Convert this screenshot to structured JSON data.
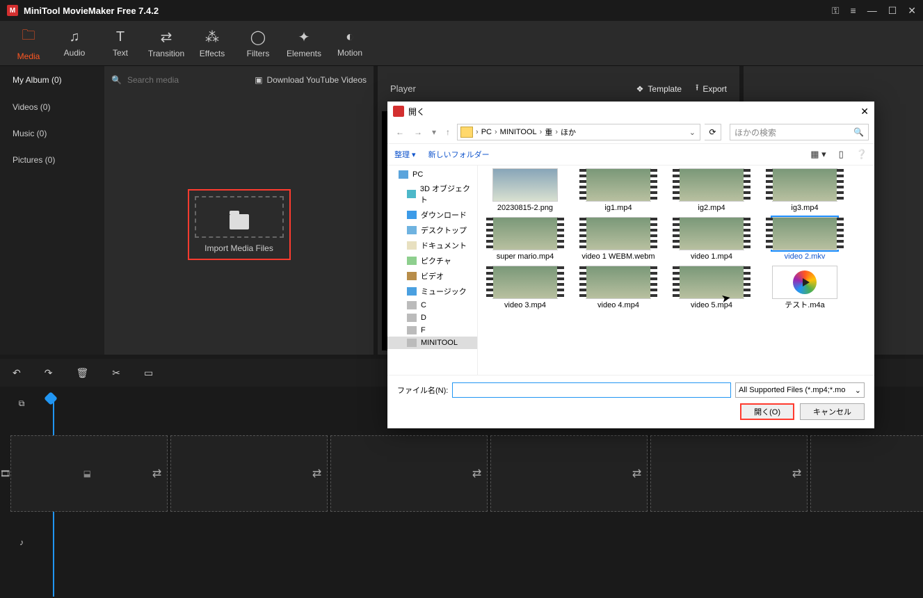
{
  "app": {
    "title": "MiniTool MovieMaker Free 7.4.2"
  },
  "tabs": {
    "media": "Media",
    "audio": "Audio",
    "text": "Text",
    "transition": "Transition",
    "effects": "Effects",
    "filters": "Filters",
    "elements": "Elements",
    "motion": "Motion"
  },
  "album": {
    "myalbum": "My Album (0)",
    "videos": "Videos (0)",
    "music": "Music (0)",
    "pictures": "Pictures (0)",
    "search_placeholder": "Search media",
    "download_yt": "Download YouTube Videos",
    "import_label": "Import Media Files"
  },
  "player": {
    "title": "Player",
    "template": "Template",
    "export": "Export"
  },
  "fileDialog": {
    "title": "開く",
    "path": {
      "pc": "PC",
      "minitool": "MINITOOL",
      "fuu": "重",
      "hoka": "ほか"
    },
    "search_placeholder": "ほかの検索",
    "toolbar": {
      "organize": "整理 ▾",
      "newfolder": "新しいフォルダー"
    },
    "tree": {
      "pc": "PC",
      "threeD": "3D オブジェクト",
      "download": "ダウンロード",
      "desktop": "デスクトップ",
      "document": "ドキュメント",
      "picture": "ピクチャ",
      "video": "ビデオ",
      "music": "ミュージック",
      "c": "C",
      "d": "D",
      "f": "F",
      "minitool": "MINITOOL"
    },
    "files": [
      {
        "name": "20230815-2.png",
        "kind": "img"
      },
      {
        "name": "ig1.mp4",
        "kind": "vid"
      },
      {
        "name": "ig2.mp4",
        "kind": "vid"
      },
      {
        "name": "ig3.mp4",
        "kind": "vid"
      },
      {
        "name": "super mario.mp4",
        "kind": "vid"
      },
      {
        "name": "video 1 WEBM.webm",
        "kind": "vid"
      },
      {
        "name": "video 1.mp4",
        "kind": "vid"
      },
      {
        "name": "video 2.mkv",
        "kind": "vid",
        "selected": true
      },
      {
        "name": "video 3.mp4",
        "kind": "vid"
      },
      {
        "name": "video 4.mp4",
        "kind": "vid"
      },
      {
        "name": "video 5.mp4",
        "kind": "vid"
      },
      {
        "name": "テスト.m4a",
        "kind": "audio"
      }
    ],
    "filename_label": "ファイル名(N):",
    "filename_value": "",
    "filter": "All Supported Files (*.mp4;*.mo",
    "open": "開く(O)",
    "cancel": "キャンセル"
  }
}
